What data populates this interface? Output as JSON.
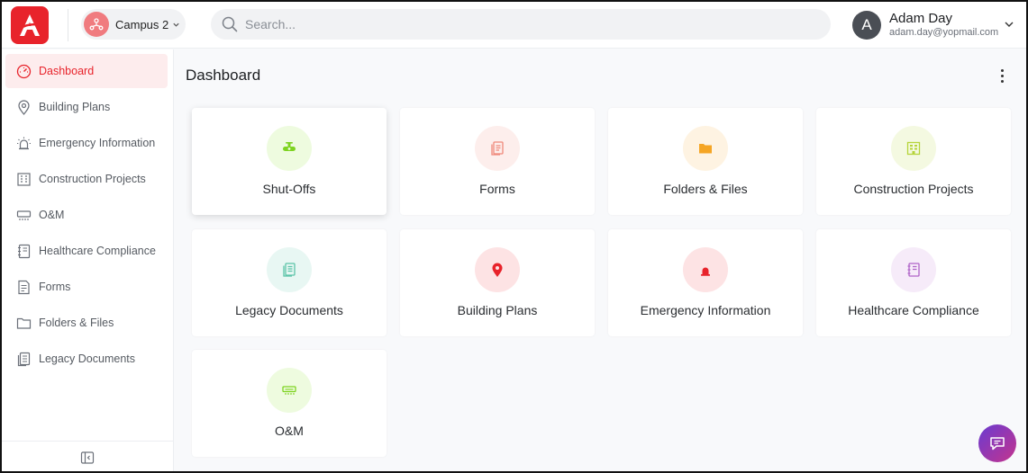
{
  "header": {
    "campus_name": "Campus 2",
    "search_placeholder": "Search...",
    "user_initial": "A",
    "user_name": "Adam Day",
    "user_email": "adam.day@yopmail.com"
  },
  "sidebar": {
    "items": [
      {
        "label": "Dashboard",
        "icon": "dashboard-gauge-icon",
        "active": true
      },
      {
        "label": "Building Plans",
        "icon": "map-pin-icon"
      },
      {
        "label": "Emergency Information",
        "icon": "alarm-light-icon"
      },
      {
        "label": "Construction Projects",
        "icon": "building-icon"
      },
      {
        "label": "O&M",
        "icon": "air-conditioner-icon"
      },
      {
        "label": "Healthcare Compliance",
        "icon": "notebook-icon"
      },
      {
        "label": "Forms",
        "icon": "form-document-icon"
      },
      {
        "label": "Folders & Files",
        "icon": "folder-icon"
      },
      {
        "label": "Legacy Documents",
        "icon": "documents-icon"
      }
    ]
  },
  "main": {
    "title": "Dashboard",
    "cards": [
      {
        "label": "Shut-Offs",
        "icon": "valve-icon",
        "color": "#7ed321",
        "bg": "#eefbdf"
      },
      {
        "label": "Forms",
        "icon": "form-document-icon",
        "color": "#f0897a",
        "bg": "#fdeeec"
      },
      {
        "label": "Folders & Files",
        "icon": "folder-icon",
        "color": "#f5a524",
        "bg": "#fef3e2"
      },
      {
        "label": "Construction Projects",
        "icon": "building-icon",
        "color": "#b6d43a",
        "bg": "#f4f9e1"
      },
      {
        "label": "Legacy Documents",
        "icon": "documents-icon",
        "color": "#5cc4a9",
        "bg": "#e8f7f3"
      },
      {
        "label": "Building Plans",
        "icon": "map-pin-icon",
        "color": "#e8232b",
        "bg": "#fde3e4"
      },
      {
        "label": "Emergency Information",
        "icon": "alarm-light-icon",
        "color": "#e8232b",
        "bg": "#fde3e4"
      },
      {
        "label": "Healthcare Compliance",
        "icon": "notebook-icon",
        "color": "#b064c8",
        "bg": "#f6ebf9"
      },
      {
        "label": "O&M",
        "icon": "air-conditioner-icon",
        "color": "#7ed321",
        "bg": "#eefbdf"
      }
    ]
  },
  "colors": {
    "accent": "#e8232b",
    "chat_gradient_start": "#6a3bd1",
    "chat_gradient_end": "#c4348d"
  }
}
